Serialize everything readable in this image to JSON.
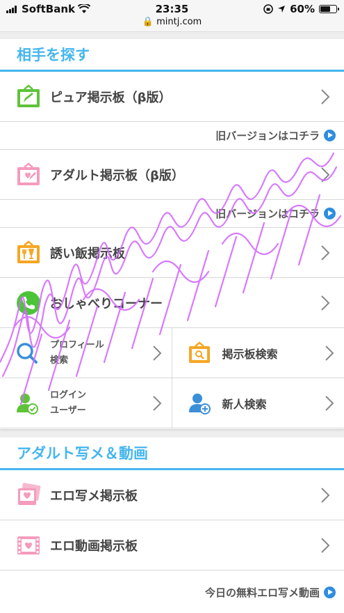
{
  "status": {
    "carrier": "SoftBank",
    "time": "23:35",
    "url": "mintj.com",
    "battery": "60%"
  },
  "section1": {
    "title": "相手を探す",
    "rows": [
      {
        "label": "ピュア掲示板（β版）",
        "sub": "旧バージョンはコチラ"
      },
      {
        "label": "アダルト掲示板（β版）",
        "sub": "旧バージョンはコチラ"
      },
      {
        "label": "誘い飯掲示板"
      },
      {
        "label": "おしゃべりコーナー"
      }
    ],
    "grid": [
      {
        "line1": "プロフィール",
        "line2": "検索"
      },
      {
        "label": "掲示板検索"
      },
      {
        "line1": "ログイン",
        "line2": "ユーザー"
      },
      {
        "label": "新人検索"
      }
    ]
  },
  "section2": {
    "title": "アダルト写メ＆動画",
    "rows": [
      {
        "label": "エロ写メ掲示板"
      },
      {
        "label": "エロ動画掲示板"
      }
    ],
    "sub": "今日の無料エロ写メ動画"
  },
  "watermark": "Mimicatchnet Watermark",
  "colors": {
    "accent": "#45b6ee",
    "pure_icon": "#5ec33a",
    "adult_icon": "#f59bbd",
    "meal_icon": "#f5a623",
    "phone_icon": "#4cc438",
    "search_icon": "#3a8fd8",
    "play": "#2e8ee0",
    "watermark": "#d36bff"
  }
}
